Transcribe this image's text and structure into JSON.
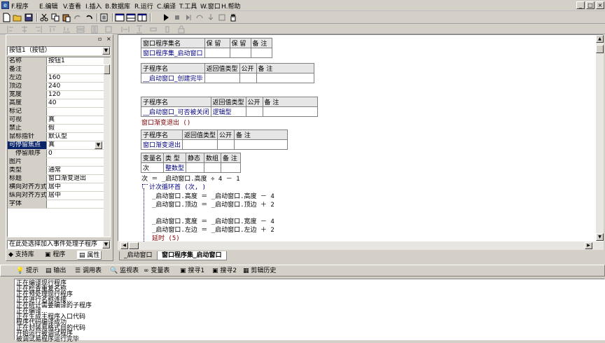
{
  "menu": {
    "icon": "e",
    "items": [
      "F.程序",
      "E.编辑",
      "V.查看",
      "I.插入",
      "B.数据库",
      "R.运行",
      "C.编译",
      "T.工具",
      "W.窗口",
      "H.帮助"
    ],
    "window_buttons": [
      "_",
      "□",
      "×"
    ]
  },
  "toolbar_icons": [
    "new-icon",
    "open-icon",
    "save-icon",
    "cut-icon",
    "copy-icon",
    "paste-icon",
    "redo-icon",
    "undo-icon",
    "find-icon",
    "layout-a-icon",
    "layout-b-icon",
    "layout-c-icon",
    "run-icon",
    "stop-icon",
    "step-icon",
    "step-over-icon",
    "step-out-icon",
    "breakpoint-icon",
    "hand-icon"
  ],
  "left_panel": {
    "object": "按钮1（按钮）",
    "properties": [
      {
        "name": "名称",
        "value": "按钮1"
      },
      {
        "name": "备注",
        "value": ""
      },
      {
        "name": "左边",
        "value": "160"
      },
      {
        "name": "顶边",
        "value": "240"
      },
      {
        "name": "宽度",
        "value": "120"
      },
      {
        "name": "高度",
        "value": "40"
      },
      {
        "name": "标记",
        "value": ""
      },
      {
        "name": "可视",
        "value": "真"
      },
      {
        "name": "禁止",
        "value": "假"
      },
      {
        "name": "鼠标指针",
        "value": "默认型"
      },
      {
        "name": "可停留焦点",
        "value": "真",
        "selected": true
      },
      {
        "name": "　停留顺序",
        "value": "0"
      },
      {
        "name": "图片",
        "value": ""
      },
      {
        "name": "类型",
        "value": "通常"
      },
      {
        "name": "标题",
        "value": "窗口渐变退出"
      },
      {
        "name": "横向对齐方式",
        "value": "居中"
      },
      {
        "name": "纵向对齐方式",
        "value": "居中"
      },
      {
        "name": "字体",
        "value": ""
      }
    ],
    "event_placeholder": "在此处选择加入事件处理子程序",
    "tabs": [
      "支持库",
      "程序",
      "属性"
    ]
  },
  "editor": {
    "t1": {
      "headers": [
        "窗口程序集名",
        "保 留",
        "保 留",
        "备 注"
      ],
      "row": [
        "窗口程序集_启动窗口",
        "",
        "",
        ""
      ]
    },
    "t2": {
      "headers": [
        "子程序名",
        "返回值类型",
        "公开",
        "备 注"
      ],
      "row": [
        "__启动窗口_创建完毕",
        "",
        "",
        ""
      ]
    },
    "t3": {
      "headers": [
        "子程序名",
        "返回值类型",
        "公开",
        "备 注"
      ],
      "row": [
        "__启动窗口_可否被关闭",
        "逻辑型",
        "",
        ""
      ]
    },
    "call": "窗口渐变退出 ()",
    "t4": {
      "headers": [
        "子程序名",
        "返回值类型",
        "公开",
        "备 注"
      ],
      "row": [
        "窗口渐变退出",
        "",
        "",
        ""
      ]
    },
    "t5": {
      "headers": [
        "变量名",
        "类 型",
        "静态",
        "数组",
        "备 注"
      ],
      "row": [
        "次",
        "整数型",
        "",
        "",
        ""
      ]
    },
    "code": [
      "次 ＝ _启动窗口.高度 ÷ 4 － 1",
      "计次循环首 (次, )",
      "_启动窗口.高度 ＝ _启动窗口.高度 － 4",
      "_启动窗口.顶边 ＝ _启动窗口.顶边 ＋ 2",
      "",
      "_启动窗口.宽度 ＝ _启动窗口.宽度 － 4",
      "_启动窗口.左边 ＝ _启动窗口.左边 ＋ 2",
      "延时 (5)"
    ]
  },
  "editor_tabs": [
    "_启动窗口",
    "窗口程序集_启动窗口"
  ],
  "output_tabs": [
    "提示",
    "输出",
    "调用表",
    "监视表",
    "变量表",
    "搜寻1",
    "搜寻2",
    "剪辑历史"
  ],
  "output_lines": [
    "正在编译现行程序",
    "正在检查重复名称",
    "正在预处理现行程序",
    "正在进行名称连接...",
    "正在统计需要编译的子程序",
    "正在编译...",
    "正在生成主程序入口代码",
    "程序代码编译成功",
    "正在封装易格式目的代码",
    "开始运行被调试程序",
    "被调试易程序运行完毕"
  ]
}
